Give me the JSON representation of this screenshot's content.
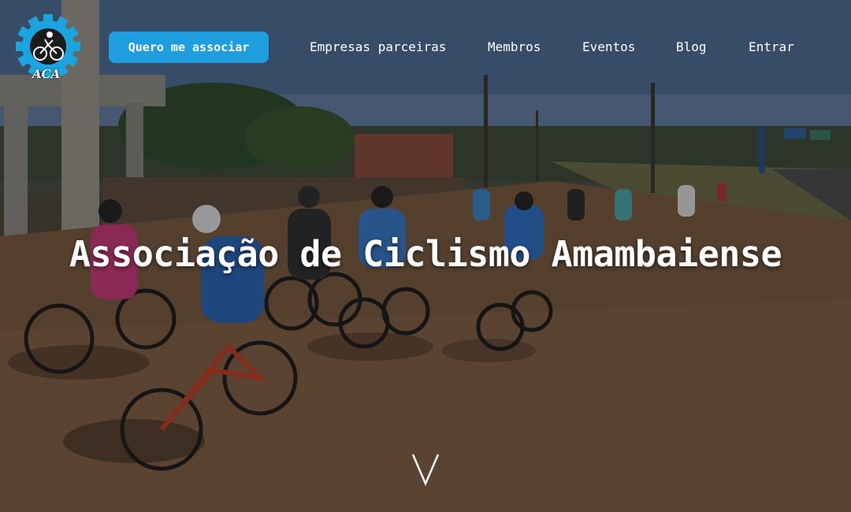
{
  "brand": {
    "logo_text": "ACA"
  },
  "header": {
    "cta_label": "Quero me associar",
    "nav": [
      {
        "label": "Empresas parceiras"
      },
      {
        "label": "Membros"
      },
      {
        "label": "Eventos"
      },
      {
        "label": "Blog"
      },
      {
        "label": "Entrar"
      }
    ]
  },
  "hero": {
    "title": "Associação de Ciclismo Amambaiense",
    "scroll_icon": "chevron-down-icon"
  },
  "colors": {
    "accent": "#1e9ddf",
    "text": "#ffffff"
  }
}
